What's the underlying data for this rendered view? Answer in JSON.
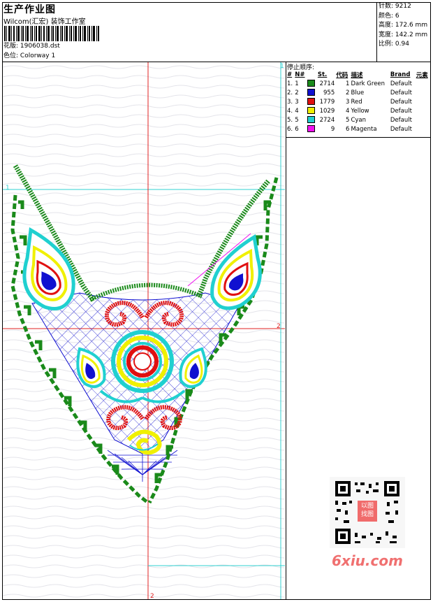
{
  "header": {
    "title": "生产作业图",
    "company": "Wilcom(汇宏) 装饰工作室",
    "design_label": "花版:",
    "design_value": "1906038.dst",
    "colorway_label": "色位:",
    "colorway_value": "Colorway 1"
  },
  "stats": [
    {
      "label": "针数",
      "value": "9212"
    },
    {
      "label": "颜色",
      "value": "6"
    },
    {
      "label": "高度",
      "value": "172.6 mm"
    },
    {
      "label": "宽度",
      "value": "142.2 mm"
    },
    {
      "label": "比例",
      "value": "0.94"
    }
  ],
  "stop_sequence": {
    "title": "停止顺序:",
    "headers": [
      "#",
      "N#",
      "St.",
      "代码",
      "描述",
      "Brand",
      "元素"
    ],
    "rows": [
      {
        "num": "1.",
        "n": "1",
        "color": "#1a8a1a",
        "st": "2714",
        "code": "1",
        "desc": "Dark Green",
        "brand": "Default"
      },
      {
        "num": "2.",
        "n": "2",
        "color": "#1010d0",
        "st": "955",
        "code": "2",
        "desc": "Blue",
        "brand": "Default"
      },
      {
        "num": "3.",
        "n": "3",
        "color": "#e01010",
        "st": "1779",
        "code": "3",
        "desc": "Red",
        "brand": "Default"
      },
      {
        "num": "4.",
        "n": "4",
        "color": "#f0f000",
        "st": "1029",
        "code": "4",
        "desc": "Yellow",
        "brand": "Default"
      },
      {
        "num": "5.",
        "n": "5",
        "color": "#20d0d0",
        "st": "2724",
        "code": "5",
        "desc": "Cyan",
        "brand": "Default"
      },
      {
        "num": "6.",
        "n": "6",
        "color": "#f010f0",
        "st": "9",
        "code": "6",
        "desc": "Magenta",
        "brand": "Default"
      }
    ]
  },
  "markers": {
    "top": "1",
    "left": "1",
    "right": "2",
    "bottom": "2"
  },
  "watermark": "6xiu.com",
  "qr_stamp": "以图 找图",
  "colors": {
    "guide_red": "#e02020",
    "guide_cyan": "#30d0d0",
    "green": "#1a8a1a",
    "blue": "#1010d0",
    "red": "#e01010",
    "yellow": "#f0f000",
    "cyan": "#20d0d0"
  }
}
